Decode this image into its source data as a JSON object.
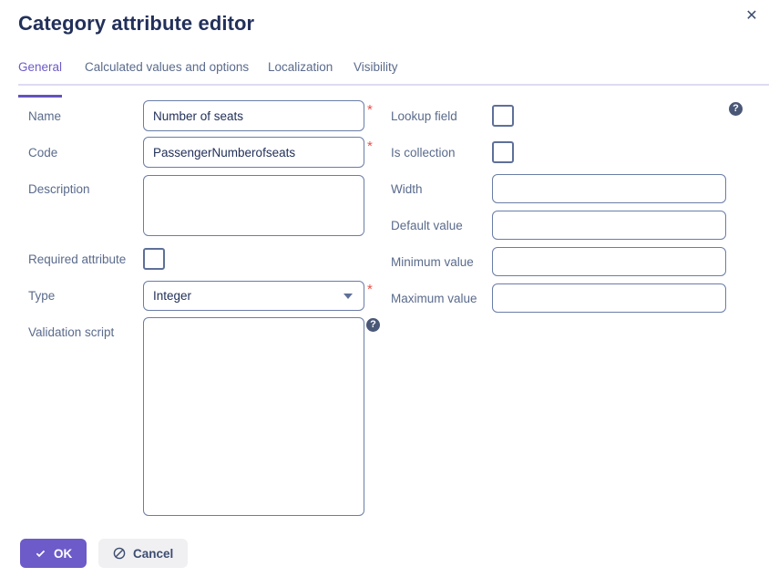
{
  "dialog": {
    "title": "Category attribute editor",
    "close_label": "✕"
  },
  "tabs": [
    {
      "label": "General",
      "active": true
    },
    {
      "label": "Calculated values and options",
      "active": false
    },
    {
      "label": "Localization",
      "active": false
    },
    {
      "label": "Visibility",
      "active": false
    }
  ],
  "left_column": {
    "name": {
      "label": "Name",
      "value": "Number of seats",
      "placeholder": "",
      "required_marker": "*"
    },
    "code": {
      "label": "Code",
      "value": "PassengerNumberofseats",
      "placeholder": "",
      "required_marker": "*"
    },
    "description": {
      "label": "Description",
      "value": "",
      "placeholder": ""
    },
    "required_attribute": {
      "label": "Required attribute",
      "checked": false
    },
    "type": {
      "label": "Type",
      "value": "Integer",
      "required_marker": "*"
    },
    "validation_script": {
      "label": "Validation script",
      "value": "",
      "placeholder": "",
      "help": "?"
    }
  },
  "right_column": {
    "lookup_field": {
      "label": "Lookup field",
      "checked": false,
      "help": "?"
    },
    "is_collection": {
      "label": "Is collection",
      "checked": false
    },
    "width": {
      "label": "Width",
      "value": "",
      "placeholder": ""
    },
    "default_value": {
      "label": "Default value",
      "value": "",
      "placeholder": ""
    },
    "minimum_value": {
      "label": "Minimum value",
      "value": "",
      "placeholder": ""
    },
    "maximum_value": {
      "label": "Maximum value",
      "value": "",
      "placeholder": ""
    }
  },
  "footer": {
    "ok_label": "OK",
    "cancel_label": "Cancel"
  },
  "colors": {
    "accent_purple": "#6c5bc8",
    "title_navy": "#22305a",
    "label_slate": "#5a6b8c",
    "border_slate": "#6a7da6",
    "required_red": "#e8514a"
  }
}
